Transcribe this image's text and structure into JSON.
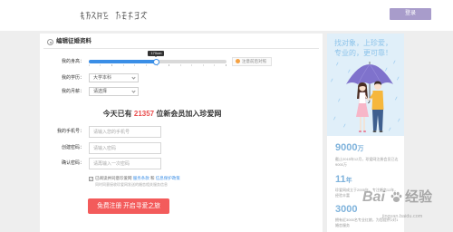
{
  "colors": {
    "login_button": "#a89ccb",
    "submit_button": "#f35b5b",
    "member_count": "#e94e4e",
    "slider_fill": "#3a8ee6",
    "link": "#3a8ee6",
    "stat_number": "#7fb3dc",
    "slogan": "#8cc3ea",
    "illustration_background": "#e0eff9"
  },
  "header": {
    "login_label": "登录"
  },
  "form": {
    "title": "编辑征婚资料",
    "title_icon": "target-icon",
    "height": {
      "label": "我的身高：",
      "value_text": "170cm",
      "slider_fraction": 0.49,
      "hint_icon": "warning-dot-icon",
      "hint": "注意前后对照"
    },
    "education": {
      "label": "我的学历：",
      "value": "大学本科"
    },
    "income": {
      "label": "我的月薪：",
      "value": "请选择"
    },
    "announcement": {
      "prefix": "今天已有 ",
      "count": "21357",
      "suffix": " 位新会员加入珍爱网"
    },
    "phone": {
      "label": "我的手机号：",
      "placeholder": "请输入您的手机号"
    },
    "password": {
      "label": "创建密码：",
      "placeholder": "请输入密码"
    },
    "password_confirm": {
      "label": "确认密码：",
      "placeholder": "请再输入一次密码"
    },
    "agreement": {
      "checked": true,
      "text": "已阅读并同意珍爱网 ",
      "terms_link": "服务条款",
      "conjunction": " 和 ",
      "privacy_link": "信息保护政策",
      "note": "同时同意接收珍爱网发送的婚恋相关服务信息"
    },
    "submit_label": "免费注册 开启寻爱之旅"
  },
  "sidebar": {
    "slogan_line1": "找对象，上珍爱，",
    "slogan_line2": "专业的，更可靠！",
    "stats": [
      {
        "value": "9000",
        "unit": "万",
        "description": "截止2015年12月，珍爱网注册会员已达9000万"
      },
      {
        "value": "11",
        "unit": "年",
        "description": "珍爱网成立于2005年，专注婚恋11年，经验丰富"
      },
      {
        "value": "3000",
        "unit": "",
        "description": "拥有近3000名专业红娘，为您提供1对1婚恋服务"
      }
    ]
  },
  "watermark": {
    "brand": "Bai",
    "icon": "paw-icon",
    "label": "经验",
    "domain": "jingyan.baidu.com"
  }
}
